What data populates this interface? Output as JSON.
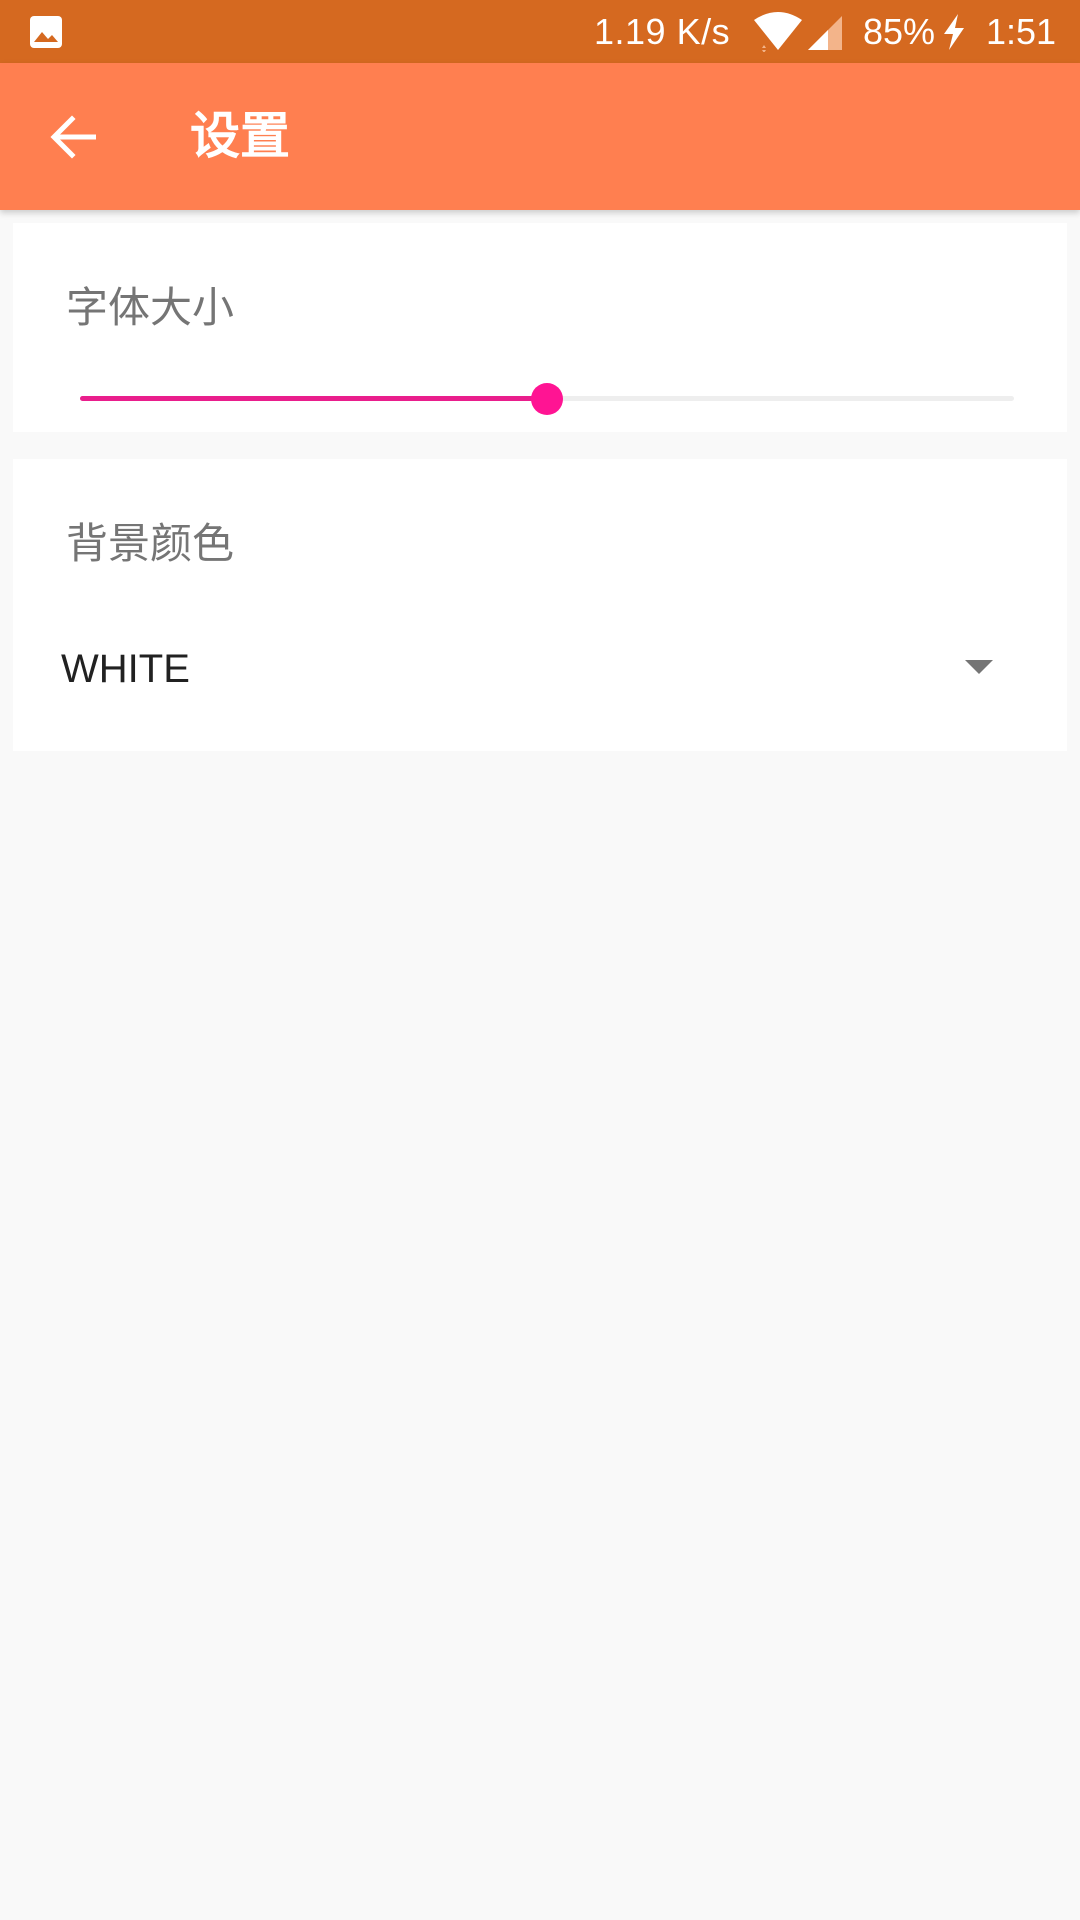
{
  "status_bar": {
    "net_speed": "1.19 K/s",
    "battery": "85%",
    "time": "1:51",
    "icons": [
      "gallery-icon",
      "wifi-icon",
      "signal-icon",
      "charging-icon"
    ]
  },
  "app_bar": {
    "back_icon": "arrow-back-icon",
    "title": "设置"
  },
  "font_size": {
    "label": "字体大小",
    "slider_fraction": 0.5
  },
  "background_color": {
    "label": "背景颜色",
    "selected": "WHITE"
  },
  "colors": {
    "status_bar": "#D56920",
    "app_bar": "#FF7F50",
    "slider_fill": "#E91E8C",
    "slider_thumb": "#FF1493",
    "page_background": "#F9F9F9"
  }
}
